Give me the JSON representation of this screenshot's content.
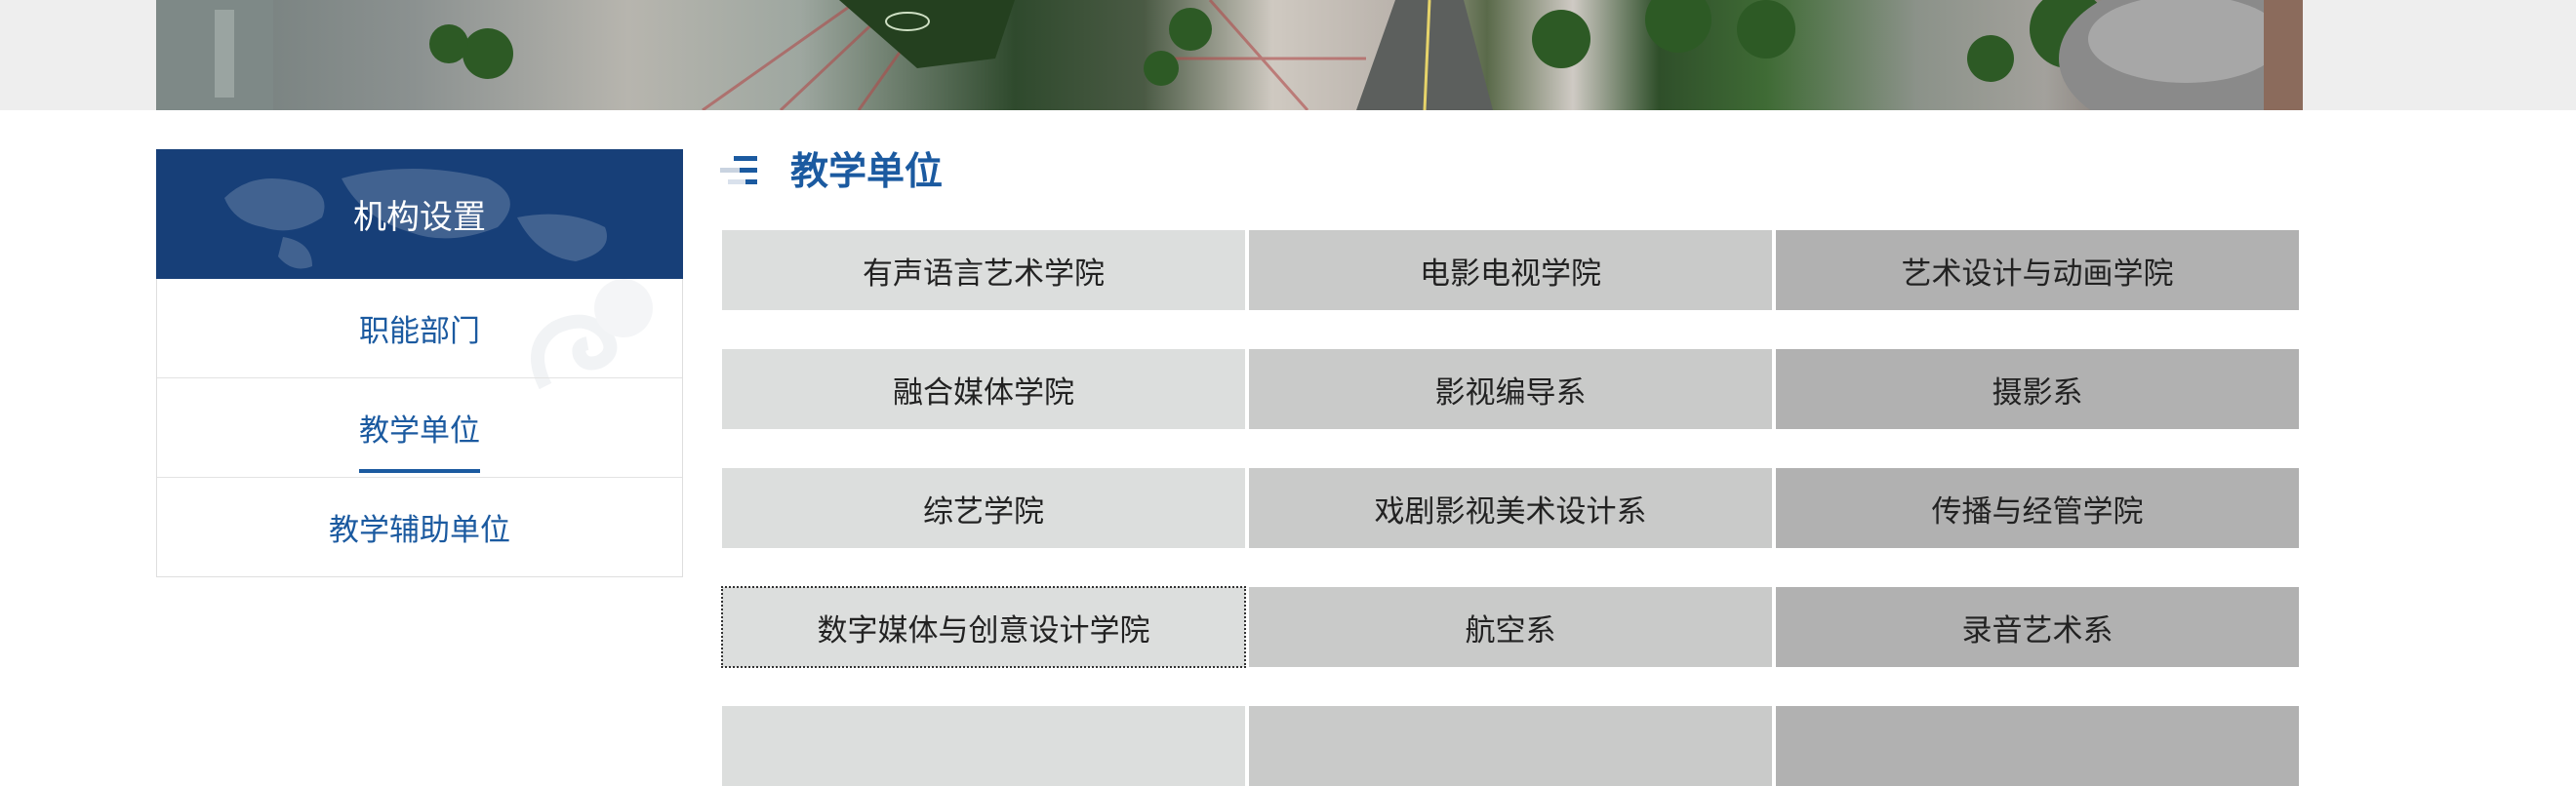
{
  "sidebar": {
    "title": "机构设置",
    "items": [
      {
        "label": "职能部门",
        "active": false
      },
      {
        "label": "教学单位",
        "active": true
      },
      {
        "label": "教学辅助单位",
        "active": false
      }
    ]
  },
  "main": {
    "section_title": "教学单位",
    "units": [
      [
        "有声语言艺术学院",
        "电影电视学院",
        "艺术设计与动画学院"
      ],
      [
        "融合媒体学院",
        "影视编导系",
        "摄影系"
      ],
      [
        "综艺学院",
        "戏剧影视美术设计系",
        "传播与经管学院"
      ],
      [
        "数字媒体与创意设计学院",
        "航空系",
        "录音艺术系"
      ],
      [
        "",
        "",
        ""
      ]
    ]
  },
  "colors": {
    "brand_blue": "#173f78",
    "link_blue": "#1b5aa0",
    "cell_col1": "#dcdedd",
    "cell_col2": "#c9cac9",
    "cell_col3": "#b1b1b1"
  }
}
